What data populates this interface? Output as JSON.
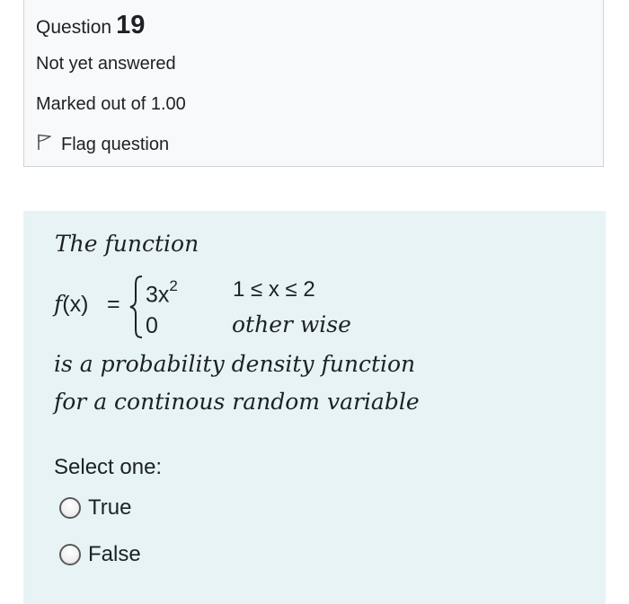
{
  "question": {
    "prefix": "Question",
    "number": "19",
    "status": "Not yet answered",
    "marks": "Marked out of 1.00",
    "flag_label": "Flag question"
  },
  "content": {
    "intro": "The function",
    "lhs_f": "f",
    "lhs_args": "(x)",
    "equals": "=",
    "case1_expr": "3x",
    "case1_exp": "2",
    "case1_cond": "1 ≤ x ≤ 2",
    "case2_expr": "0",
    "case2_cond": "other wise",
    "line1": "is a probability density function",
    "line2": "for a continous random variable"
  },
  "answer": {
    "prompt": "Select one:",
    "options": [
      {
        "label": "True"
      },
      {
        "label": "False"
      }
    ]
  }
}
